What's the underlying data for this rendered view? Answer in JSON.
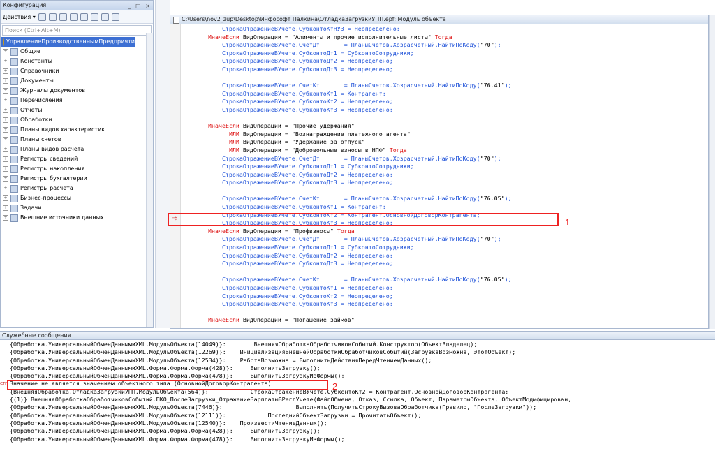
{
  "config": {
    "title": "Конфигурация",
    "win_buttons": "_ □ ×",
    "actions_label": "Действия ▾",
    "search_placeholder": "Поиск (Ctrl+Alt+M)",
    "root": "УправлениеПроизводственнымПредприятием",
    "items": [
      "Общие",
      "Константы",
      "Справочники",
      "Документы",
      "Журналы документов",
      "Перечисления",
      "Отчеты",
      "Обработки",
      "Планы видов характеристик",
      "Планы счетов",
      "Планы видов расчета",
      "Регистры сведений",
      "Регистры накопления",
      "Регистры бухгалтерии",
      "Регистры расчета",
      "Бизнес-процессы",
      "Задачи",
      "Внешние источники данных"
    ]
  },
  "editor": {
    "title": "C:\\Users\\nov2_zup\\Desktop\\Инфософт Палкина\\ОтладкаЗагрузкиУПП.epf: Модуль объекта",
    "lines": [
      "            СтрокаОтражениеВУчете.СубконтоКтНУ3 = Неопределено;",
      "        ИначеЕсли ВидОперации = \"Алименты и прочие исполнительные листы\" Тогда",
      "            СтрокаОтражениеВУчете.СчетДт       = ПланыСчетов.Хозрасчетный.НайтиПоКоду(\"70\");",
      "            СтрокаОтражениеВУчете.СубконтоДт1 = СубконтоСотрудники;",
      "            СтрокаОтражениеВУчете.СубконтоДт2 = Неопределено;",
      "            СтрокаОтражениеВУчете.СубконтоДт3 = Неопределено;",
      "",
      "            СтрокаОтражениеВУчете.СчетКт       = ПланыСчетов.Хозрасчетный.НайтиПоКоду(\"76.41\");",
      "            СтрокаОтражениеВУчете.СубконтоКт1 = Контрагент;",
      "            СтрокаОтражениеВУчете.СубконтоКт2 = Неопределено;",
      "            СтрокаОтражениеВУчете.СубконтоКт3 = Неопределено;",
      "",
      "        ИначеЕсли ВидОперации = \"Прочие удержания\"",
      "              ИЛИ ВидОперации = \"Вознаграждение платежного агента\"",
      "              ИЛИ ВидОперации = \"Удержание за отпуск\"",
      "              ИЛИ ВидОперации = \"Добровольные взносы в НПФ\" Тогда",
      "            СтрокаОтражениеВУчете.СчетДт       = ПланыСчетов.Хозрасчетный.НайтиПоКоду(\"70\");",
      "            СтрокаОтражениеВУчете.СубконтоДт1 = СубконтоСотрудники;",
      "            СтрокаОтражениеВУчете.СубконтоДт2 = Неопределено;",
      "            СтрокаОтражениеВУчете.СубконтоДт3 = Неопределено;",
      "",
      "            СтрокаОтражениеВУчете.СчетКт       = ПланыСчетов.Хозрасчетный.НайтиПоКоду(\"76.05\");",
      "            СтрокаОтражениеВУчете.СубконтоКт1 = Контрагент;",
      "            СтрокаОтражениеВУчете.СубконтоКт2 = Контрагент.ОсновнойДоговорКонтрагента;",
      "            СтрокаОтражениеВУчете.СубконтоКт3 = Неопределено;",
      "        ИначеЕсли ВидОперации = \"Профвзносы\" Тогда",
      "            СтрокаОтражениеВУчете.СчетДт       = ПланыСчетов.Хозрасчетный.НайтиПоКоду(\"70\");",
      "            СтрокаОтражениеВУчете.СубконтоДт1 = СубконтоСотрудники;",
      "            СтрокаОтражениеВУчете.СубконтоДт2 = Неопределено;",
      "            СтрокаОтражениеВУчете.СубконтоДт3 = Неопределено;",
      "",
      "            СтрокаОтражениеВУчете.СчетКт       = ПланыСчетов.Хозрасчетный.НайтиПоКоду(\"76.05\");",
      "            СтрокаОтражениеВУчете.СубконтоКт1 = Неопределено;",
      "            СтрокаОтражениеВУчете.СубконтоКт2 = Неопределено;",
      "            СтрокаОтражениеВУчете.СубконтоКт3 = Неопределено;",
      "",
      "        ИначеЕсли ВидОперации = \"Погашение займов\""
    ]
  },
  "messages": {
    "title": "Служебные сообщения",
    "err_tag": "err",
    "lines": [
      "{Обработка.УниверсальныйОбменДаннымиXML.МодульОбъекта(14049)}:        ВнешняяОбработкаОбработчиковСобытий.Конструктор(ОбъектВладелец);",
      "{Обработка.УниверсальныйОбменДаннымиXML.МодульОбъекта(12269)}:    ИнициализацияВнешнейОбработкиОбработчиковСобытий(ЗагрузкаВозможна, ЭтотОбъект);",
      "{Обработка.УниверсальныйОбменДаннымиXML.МодульОбъекта(12534)}:    РаботаВозможна = ВыполнитьДействияПередЧтениемДанных();",
      "{Обработка.УниверсальныйОбменДаннымиXML.Форма.Форма.Форма(428)}:     ВыполнитьЗагрузку();",
      "{Обработка.УниверсальныйОбменДаннымиXML.Форма.Форма.Форма(478)}:     ВыполнитьЗагрузкуИзФормы();",
      "Значение не является значением объектного типа (ОсновнойДоговорКонтрагента)",
      "{ВнешняяОбработка.ОтладкаЗагрузкиУПП.МодульОбъекта(564)}:            СтрокаОтражениеВУчете.СубконтоКт2 = Контрагент.ОсновнойДоговорКонтрагента;",
      "{(1)}:ВнешняяОбработкаОбработчиковСобытий.ПКО_ПослеЗагрузки_ОтражениеЗарплатыВРеглУчете(ФайлОбмена, Отказ, Ссылка, Объект, ПараметрыОбъекта, ОбъектМодифицирован,",
      "{Обработка.УниверсальныйОбменДаннымиXML.МодульОбъекта(7446)}:                     Выполнить(ПолучитьСтрокуВызоваОбработчика(Правило, \"ПослеЗагрузки\"));",
      "{Обработка.УниверсальныйОбменДаннымиXML.МодульОбъекта(12111)}:            ПоследнийОбъектЗагрузки = ПрочитатьОбъект();",
      "{Обработка.УниверсальныйОбменДаннымиXML.МодульОбъекта(12540)}:    ПроизвестиЧтениеДанных();",
      "{Обработка.УниверсальныйОбменДаннымиXML.Форма.Форма.Форма(428)}:     ВыполнитьЗагрузку();",
      "{Обработка.УниверсальныйОбменДаннымиXML.Форма.Форма.Форма(478)}:     ВыполнитьЗагрузкуИзФормы();"
    ]
  },
  "annotations": {
    "one": "1",
    "two": "2"
  }
}
